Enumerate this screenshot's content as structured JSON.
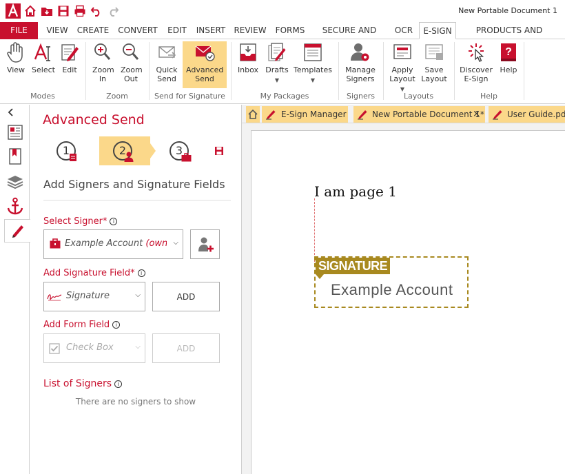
{
  "window": {
    "document_title": "New Portable Document 1"
  },
  "quick_access": [
    "app-logo-icon",
    "home-icon",
    "open-folder-icon",
    "save-icon",
    "print-icon",
    "undo-icon",
    "redo-icon"
  ],
  "menu": {
    "file": "FILE",
    "items": [
      "VIEW",
      "CREATE",
      "CONVERT",
      "EDIT",
      "INSERT",
      "REVIEW",
      "FORMS",
      "SECURE AND SIGN",
      "OCR",
      "E-SIGN",
      "PRODUCTS AND PRICING"
    ],
    "active": "E-SIGN"
  },
  "ribbon": {
    "buttons": {
      "view": "View",
      "select": "Select",
      "edit": "Edit",
      "zoom_in": "Zoom In",
      "zoom_out": "Zoom Out",
      "quick_send": "Quick Send",
      "advanced_send": "Advanced Send",
      "inbox": "Inbox",
      "drafts": "Drafts",
      "templates": "Templates",
      "manage_signers": "Manage Signers",
      "apply_layout": "Apply Layout",
      "save_layout": "Save Layout",
      "discover_esign": "Discover E-Sign",
      "help": "Help"
    },
    "groups": {
      "modes": "Modes",
      "zoom": "Zoom",
      "send_for_signature": "Send for Signature",
      "my_packages": "My Packages",
      "signers": "Signers",
      "layouts": "Layouts",
      "help": "Help"
    }
  },
  "panel": {
    "title": "Advanced Send",
    "steps": [
      "1",
      "2",
      "3"
    ],
    "active_step": 2,
    "subhead": "Add Signers and Signature Fields",
    "select_signer": {
      "label": "Select Signer",
      "required": "*",
      "value_name": "Example Account",
      "value_role": "(owner)"
    },
    "add_signature_field": {
      "label": "Add Signature Field",
      "required": "*",
      "value": "Signature",
      "button": "ADD"
    },
    "add_form_field": {
      "label": "Add Form Field",
      "value": "Check Box",
      "button": "ADD"
    },
    "list_of_signers": {
      "label": "List of Signers",
      "empty_text": "There are no signers to show"
    }
  },
  "doc_tabs": [
    {
      "label": "E-Sign Manager"
    },
    {
      "label": "New Portable Document 1*",
      "close": "×"
    },
    {
      "label": "User Guide.pdf"
    }
  ],
  "document": {
    "page_text": "I am page 1",
    "signature_field": {
      "tag": "SIGNATURE",
      "signer": "Example Account"
    }
  },
  "colors": {
    "accent": "#c8102e",
    "selected": "#fbd88a",
    "signature": "#a8891f"
  }
}
